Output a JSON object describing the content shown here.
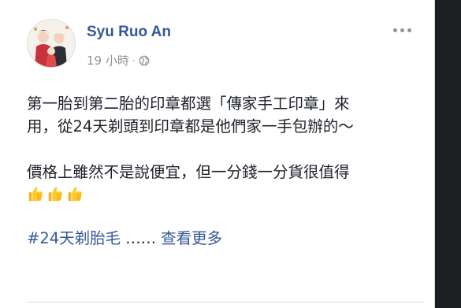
{
  "post": {
    "author": "Syu Ruo An",
    "time": "19 小時",
    "separator": "·",
    "privacy_icon": "globe-icon",
    "more_icon": "more-options-icon",
    "line1": "第一胎到第二胎的印章都選「傳家手工印章」來",
    "line2": "用，從24天剃頭到印章都是他們家一手包辦的～",
    "line3": "價格上雖然不是說便宜，但一分錢一分貨很值得",
    "thumbs_icon": "thumbs-up-emoji",
    "hashtag": "#24天剃胎毛",
    "ellipsis": "……",
    "see_more": "查看更多"
  },
  "colors": {
    "link": "#365899",
    "meta": "#90949c",
    "text": "#1d2129"
  }
}
